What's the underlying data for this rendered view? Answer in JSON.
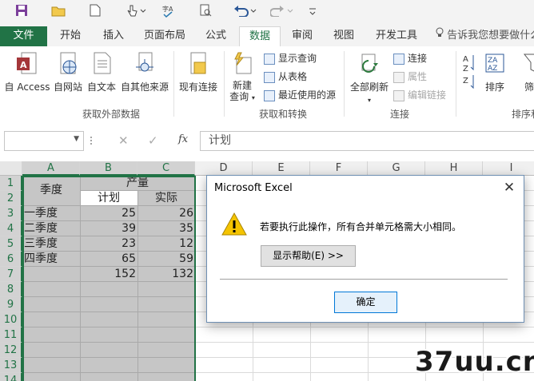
{
  "ribbon_tabs": {
    "file": "文件",
    "home": "开始",
    "insert": "插入",
    "layout": "页面布局",
    "formulas": "公式",
    "data": "数据",
    "review": "审阅",
    "view": "视图",
    "developer": "开发工具",
    "tell_me": "告诉我您想要做什么"
  },
  "ribbon": {
    "from_access": "自 Access",
    "from_web": "自网站",
    "from_text": "自文本",
    "from_other": "自其他来源",
    "existing_conn": "现有连接",
    "group_external": "获取外部数据",
    "new_query_1": "新建",
    "new_query_2": "查询",
    "show_queries": "显示查询",
    "from_table": "从表格",
    "recent_sources": "最近使用的源",
    "group_transform": "获取和转换",
    "refresh_all": "全部刷新",
    "connections": "连接",
    "properties": "属性",
    "edit_links": "编辑链接",
    "group_connections": "连接",
    "sort": "排序",
    "group_sort": "排序和",
    "filter_cut": "筛"
  },
  "formula_bar": {
    "namebox": "",
    "fx": "fx",
    "content": "计划"
  },
  "columns": [
    "A",
    "B",
    "C",
    "D",
    "E",
    "F",
    "G",
    "H",
    "I"
  ],
  "rows": [
    "1",
    "2",
    "3",
    "4",
    "5",
    "6",
    "7",
    "8",
    "9",
    "10",
    "11",
    "12",
    "13",
    "14"
  ],
  "sheet": {
    "a_header": "季度",
    "production": "产量",
    "plan": "计划",
    "actual": "实际",
    "records": [
      {
        "quarter": "一季度",
        "plan": "25",
        "actual": "26"
      },
      {
        "quarter": "二季度",
        "plan": "39",
        "actual": "35"
      },
      {
        "quarter": "三季度",
        "plan": "23",
        "actual": "12"
      },
      {
        "quarter": "四季度",
        "plan": "65",
        "actual": "59"
      }
    ],
    "total_plan": "152",
    "total_actual": "132"
  },
  "dialog": {
    "title": "Microsoft Excel",
    "message": "若要执行此操作，所有合并单元格需大小相同。",
    "help_button": "显示帮助(E) >>",
    "ok_button": "确定"
  },
  "watermark": "37uu.cn",
  "colors": {
    "accent": "#217346",
    "selection": "#c6c6c6",
    "warning": "#f5c400"
  }
}
